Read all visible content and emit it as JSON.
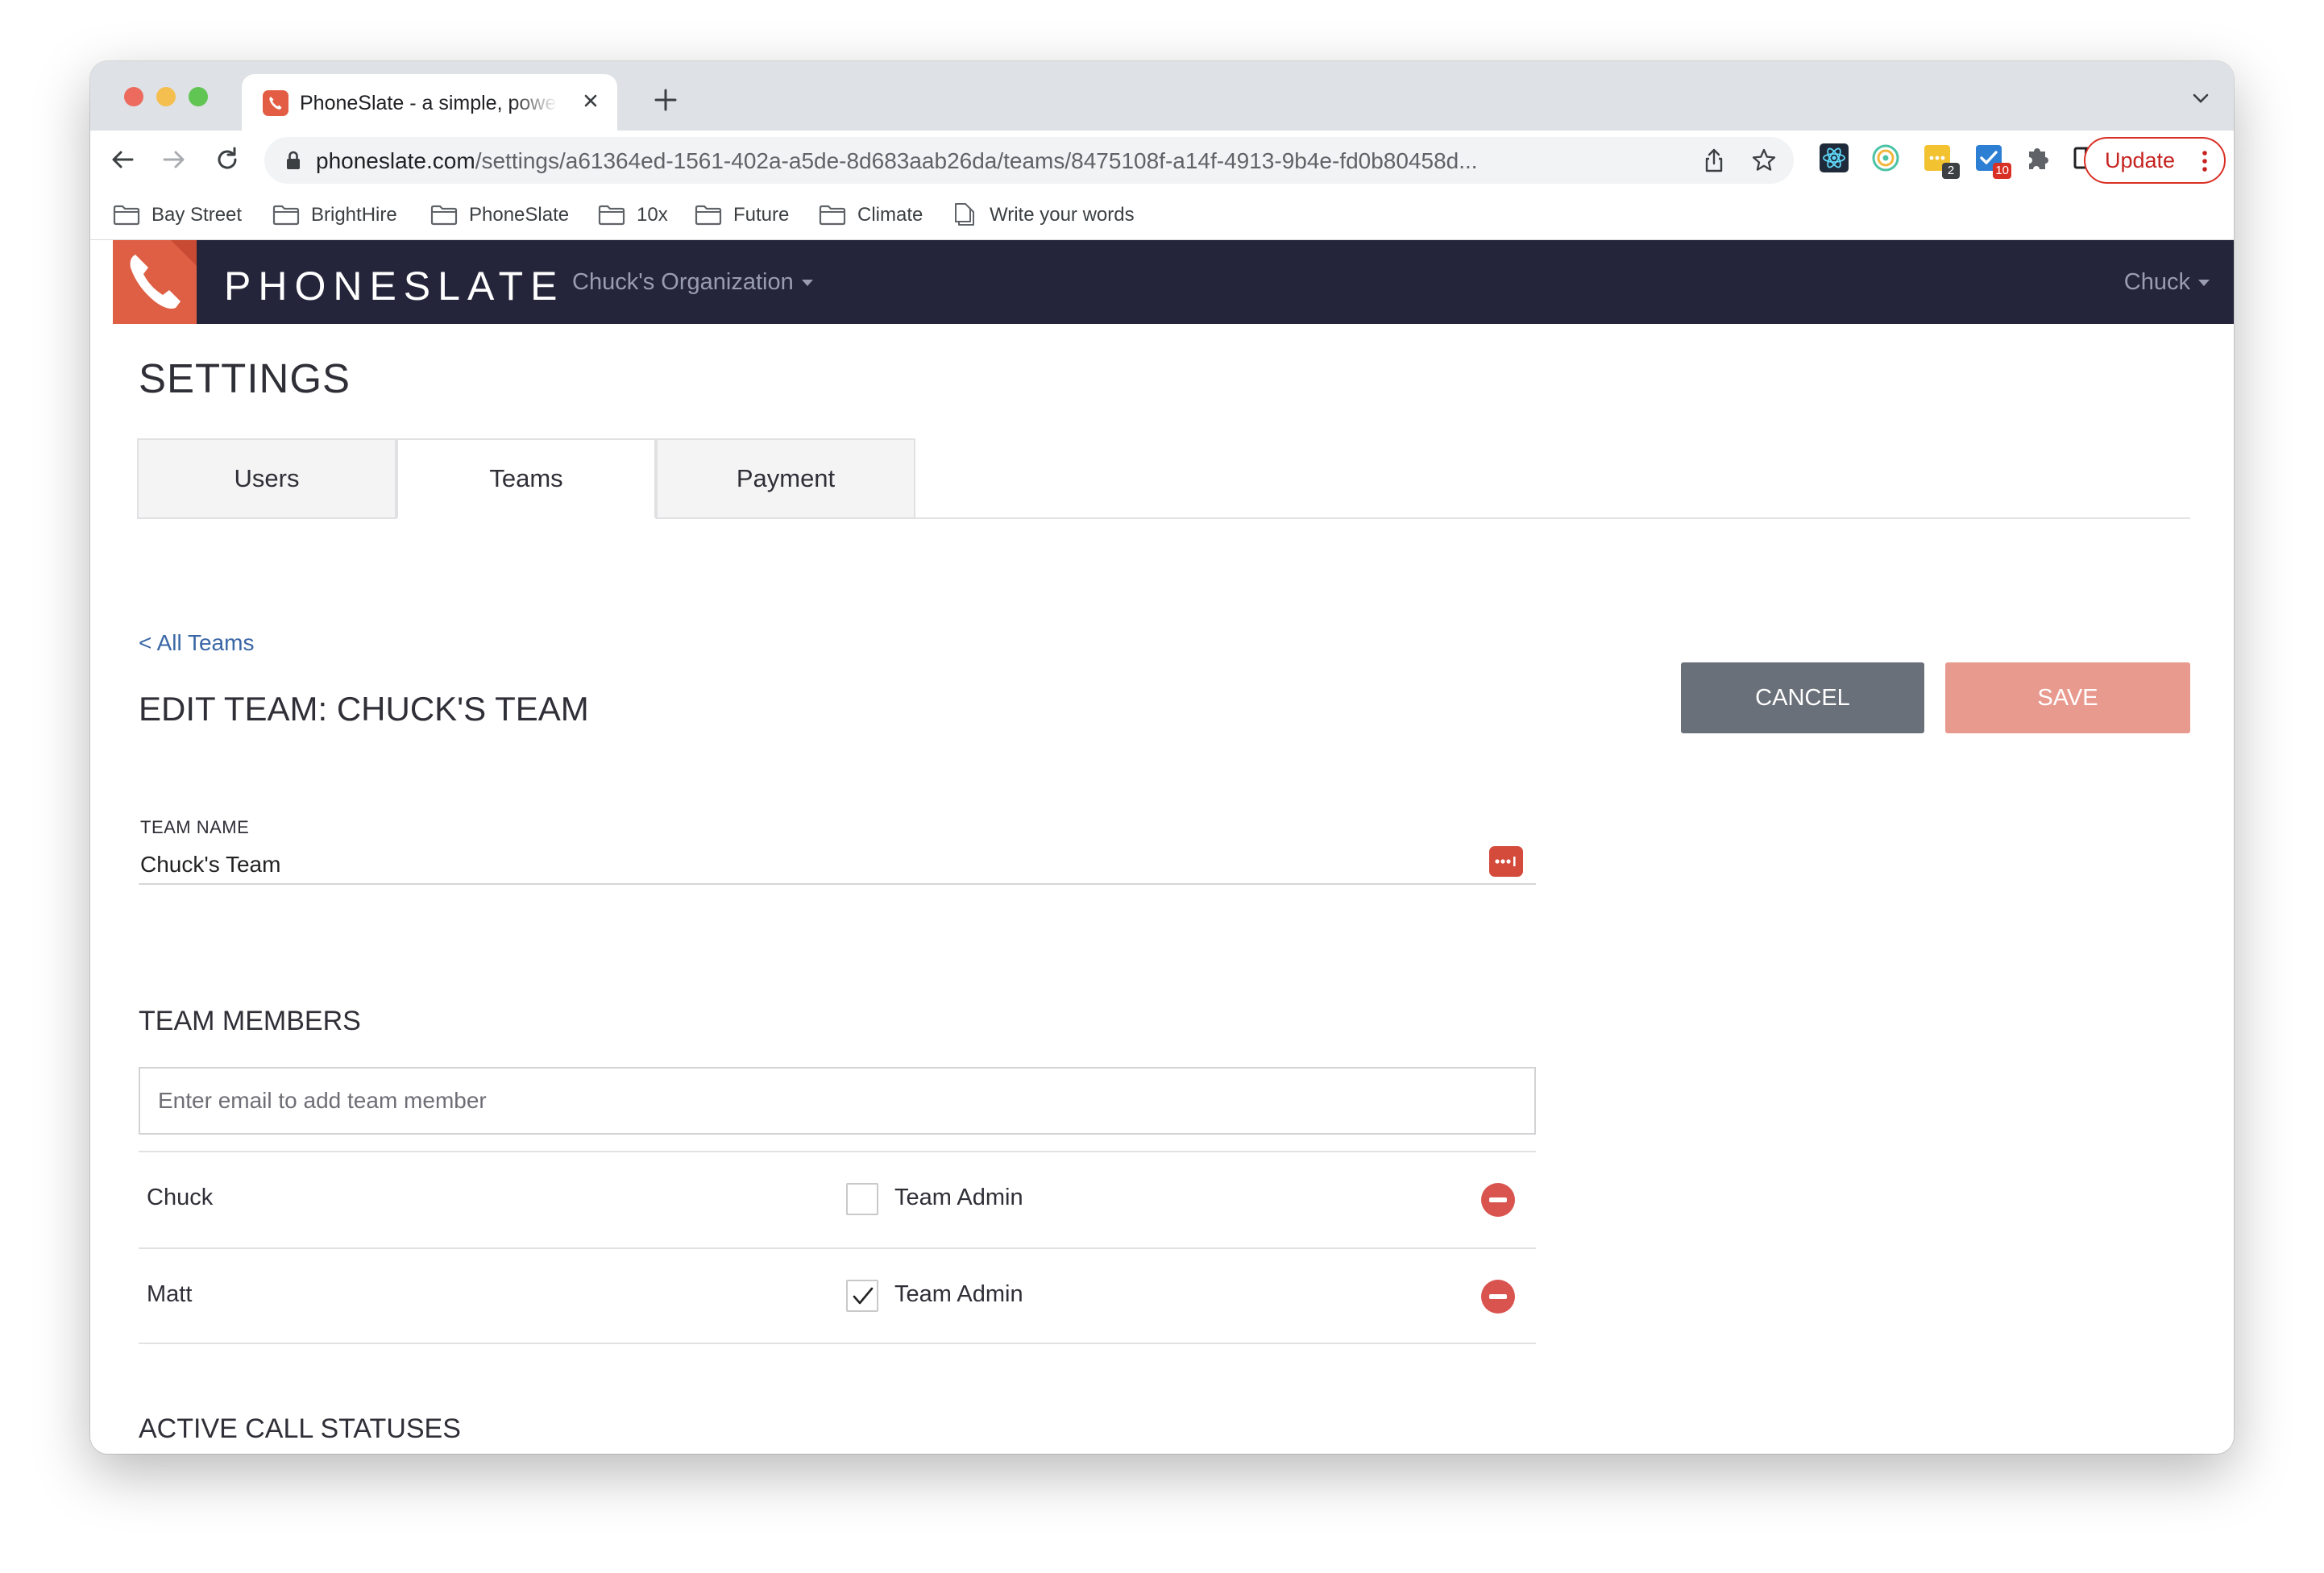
{
  "browser": {
    "tab": {
      "title": "PhoneSlate - a simple, powerful"
    },
    "url": {
      "host": "phoneslate.com",
      "path": "/settings/a61364ed-1561-402a-a5de-8d683aab26da/teams/8475108f-a14f-4913-9b4e-fd0b80458d..."
    },
    "extensions": [
      {
        "name": "react-devtools-icon",
        "color": "#1e2a3a"
      },
      {
        "name": "circle-extension-icon",
        "color": "#4cc3a5"
      },
      {
        "name": "notes-extension-icon",
        "color": "#f2c230",
        "badge": "2",
        "badge_color": "#3c4043"
      },
      {
        "name": "tasks-extension-icon",
        "color": "#2d7fd3",
        "badge": "10",
        "badge_color": "#d93025"
      },
      {
        "name": "puzzle-icon",
        "color": "#5f6368"
      },
      {
        "name": "side-panel-icon",
        "color": "#202124"
      }
    ],
    "update_label": "Update",
    "bookmarks": [
      {
        "label": "Bay Street",
        "icon": "folder-icon"
      },
      {
        "label": "BrightHire",
        "icon": "folder-icon"
      },
      {
        "label": "PhoneSlate",
        "icon": "folder-icon"
      },
      {
        "label": "10x",
        "icon": "folder-icon"
      },
      {
        "label": "Future",
        "icon": "folder-icon"
      },
      {
        "label": "Climate",
        "icon": "folder-icon"
      },
      {
        "label": "Write your words",
        "icon": "page-icon"
      }
    ]
  },
  "app": {
    "brand": "PHONESLATE",
    "org_switcher": "Chuck's Organization",
    "user_menu": "Chuck",
    "colors": {
      "header": "#24253a",
      "brand": "#df5f44",
      "link": "#3966a4",
      "danger": "#d9534f"
    }
  },
  "settings": {
    "title": "SETTINGS",
    "tabs": [
      {
        "label": "Users",
        "active": false
      },
      {
        "label": "Teams",
        "active": true
      },
      {
        "label": "Payment",
        "active": false
      }
    ],
    "back_link": "< All Teams",
    "edit_title": "EDIT TEAM: CHUCK'S TEAM",
    "cancel_label": "CANCEL",
    "save_label": "SAVE",
    "team_name": {
      "label": "TEAM NAME",
      "value": "Chuck's Team"
    },
    "members": {
      "title": "TEAM MEMBERS",
      "placeholder": "Enter email to add team member",
      "admin_label": "Team Admin",
      "rows": [
        {
          "name": "Chuck",
          "team_admin": false
        },
        {
          "name": "Matt",
          "team_admin": true
        }
      ]
    },
    "active_call_statuses": {
      "title": "ACTIVE CALL STATUSES"
    }
  }
}
